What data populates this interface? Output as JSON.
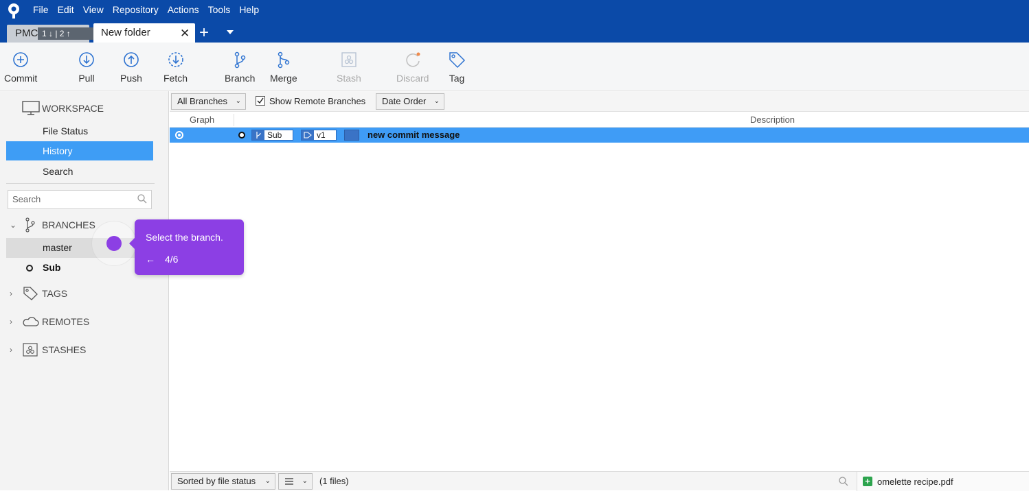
{
  "menu": [
    "File",
    "Edit",
    "View",
    "Repository",
    "Actions",
    "Tools",
    "Help"
  ],
  "tabs": {
    "repo_tab_label": "PMC",
    "repo_tab_badge": "1 ↓ | 2 ↑",
    "active_tab_label": "New folder",
    "close_glyph": "✕",
    "add_glyph": "+"
  },
  "toolbar": {
    "commit": "Commit",
    "pull": "Pull",
    "push": "Push",
    "fetch": "Fetch",
    "branch": "Branch",
    "merge": "Merge",
    "stash": "Stash",
    "discard": "Discard",
    "tag": "Tag"
  },
  "sidebar": {
    "workspace_title": "WORKSPACE",
    "items": [
      {
        "label": "File Status"
      },
      {
        "label": "History"
      },
      {
        "label": "Search"
      }
    ],
    "search_placeholder": "Search",
    "branches_title": "BRANCHES",
    "branches": [
      {
        "label": "master"
      },
      {
        "label": "Sub"
      }
    ],
    "tags_title": "TAGS",
    "remotes_title": "REMOTES",
    "stashes_title": "STASHES"
  },
  "filters": {
    "branches_select": "All Branches",
    "show_remote_label": "Show Remote Branches",
    "show_remote_checked": true,
    "order_select": "Date Order"
  },
  "columns": {
    "graph": "Graph",
    "description": "Description"
  },
  "commit": {
    "branch_ref": "Sub",
    "tag_ref": "v1",
    "message": "new commit message"
  },
  "bottom": {
    "sort_select": "Sorted by file status",
    "files_count": "(1 files)",
    "file_name": "omelette recipe.pdf"
  },
  "tooltip": {
    "text": "Select the branch.",
    "back": "←",
    "step": "4/6"
  },
  "colors": {
    "topbar": "#0b4aa8",
    "selection": "#3e9df5",
    "tooltip": "#8c3fe4"
  }
}
